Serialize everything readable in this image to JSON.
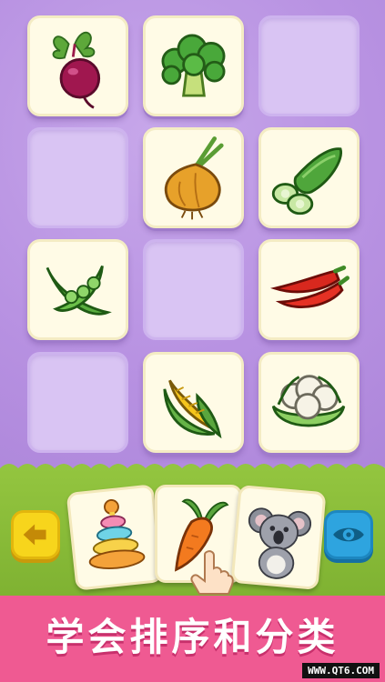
{
  "board": {
    "grid": [
      [
        "beet",
        "broccoli",
        "empty"
      ],
      [
        "empty",
        "onion",
        "cucumber"
      ],
      [
        "peas",
        "empty",
        "chili"
      ],
      [
        "empty",
        "corn",
        "cauliflower"
      ]
    ]
  },
  "tray": {
    "cards": [
      "stacking-rings",
      "carrot",
      "koala"
    ]
  },
  "controls": {
    "back_icon": "arrow-left-icon",
    "eye_icon": "eye-icon"
  },
  "banner": {
    "text": "学会排序和分类",
    "watermark": "WWW.QT6.COM"
  },
  "colors": {
    "board": "#b892e2",
    "tray": "#8cc03c",
    "banner": "#ef5a92",
    "back_button": "#f7d51c",
    "eye_button": "#2ea4df"
  }
}
